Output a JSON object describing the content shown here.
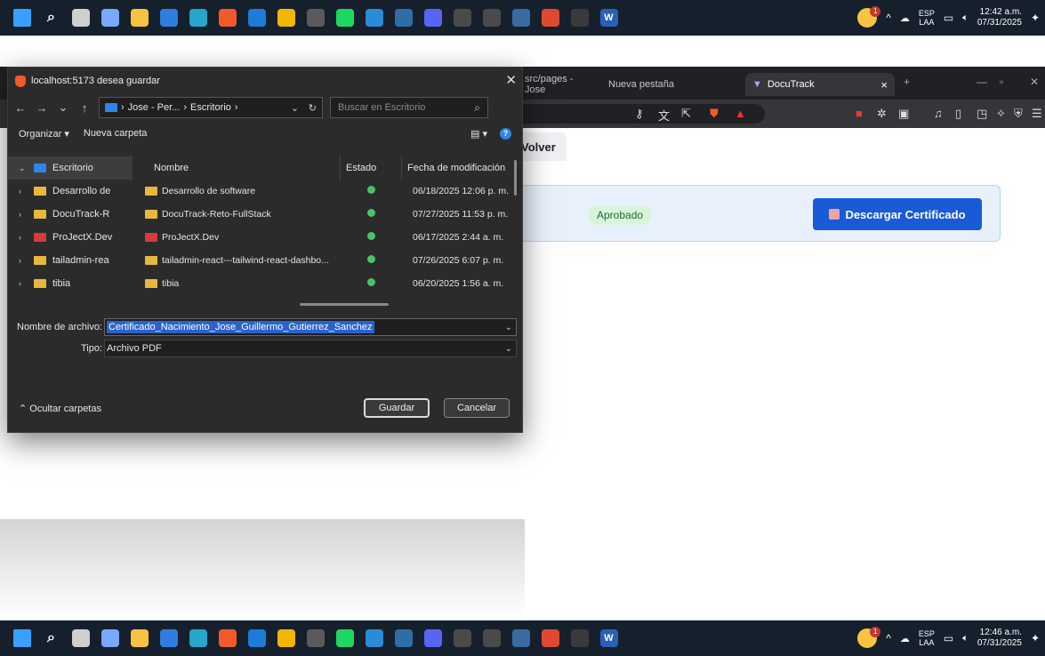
{
  "taskbar_top": {
    "lang": [
      "ESP",
      "LAA"
    ],
    "time": "12:42 a.m.",
    "date": "07/31/2025",
    "notif_count": "1",
    "icons": [
      "windows-start-icon",
      "search-icon",
      "file-explorer-icon",
      "copilot-icon",
      "folder-icon",
      "store-icon",
      "edge-icon",
      "brave-icon",
      "outlook-icon",
      "chrome-icon",
      "mail-icon",
      "spotify-icon",
      "vscode-icon",
      "steam-icon",
      "discord-icon",
      "terminal-icon",
      "terminal2-icon",
      "postgres-icon",
      "app-icon",
      "cmd-icon",
      "word-icon"
    ]
  },
  "taskbar_bottom": {
    "lang": [
      "ESP",
      "LAA"
    ],
    "time": "12:46 a.m.",
    "date": "07/31/2025",
    "notif_count": "1"
  },
  "browser": {
    "tabs": [
      {
        "label": "src/pages - Jose"
      },
      {
        "label": "Nueva pestaña"
      },
      {
        "label": "DocuTrack",
        "active": true
      }
    ],
    "page": {
      "volver_label": "Volver",
      "status_badge": "Aprobado",
      "download_button": "Descargar Certificado"
    }
  },
  "dialog": {
    "title": "localhost:5173 desea guardar",
    "breadcrumb": [
      "Jose - Per...",
      "Escritorio"
    ],
    "search_placeholder": "Buscar en Escritorio",
    "organize_label": "Organizar ▾",
    "new_folder_label": "Nueva carpeta",
    "nav_items": [
      {
        "label": "Escritorio",
        "kind": "blue",
        "selected": true
      },
      {
        "label": "Desarrollo de",
        "kind": "yellow"
      },
      {
        "label": "DocuTrack-R",
        "kind": "yellow"
      },
      {
        "label": "ProJectX.Dev",
        "kind": "red"
      },
      {
        "label": "tailadmin-rea",
        "kind": "yellow"
      },
      {
        "label": "tibia",
        "kind": "yellow"
      }
    ],
    "columns": [
      "Nombre",
      "Estado",
      "Fecha de modificación"
    ],
    "files": [
      {
        "name": "Desarrollo de software",
        "kind": "yellow",
        "date": "06/18/2025 12:06 p. m."
      },
      {
        "name": "DocuTrack-Reto-FullStack",
        "kind": "yellow",
        "date": "07/27/2025 11:53 p. m."
      },
      {
        "name": "ProJectX.Dev",
        "kind": "red",
        "date": "06/17/2025 2:44 a. m."
      },
      {
        "name": "tailadmin-react---tailwind-react-dashbo...",
        "kind": "yellow",
        "date": "07/26/2025 6:07 p. m."
      },
      {
        "name": "tibia",
        "kind": "yellow",
        "date": "06/20/2025 1:56 a. m."
      }
    ],
    "filename_label": "Nombre de archivo:",
    "filename_value": "Certificado_Nacimiento_Jose_Guillermo_Gutierrez_Sanchez",
    "type_label": "Tipo:",
    "type_value": "Archivo PDF",
    "hide_folders": "Ocultar carpetas",
    "save_button": "Guardar",
    "cancel_button": "Cancelar"
  }
}
